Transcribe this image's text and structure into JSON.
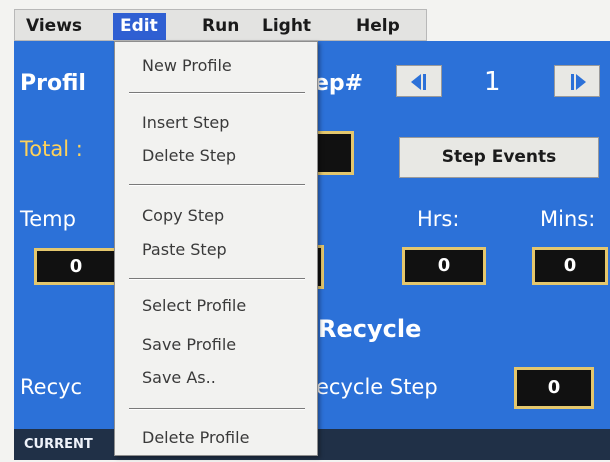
{
  "menubar": {
    "items": [
      "Views",
      "Edit",
      "Run",
      "Light",
      "Help"
    ],
    "active": "Edit"
  },
  "screen": {
    "profile_label": "Profil",
    "step_label": "ep#",
    "step_value": "1",
    "total_label": "Total :",
    "step_events_label": "Step Events",
    "temp_label": "Temp",
    "temp_value": "0",
    "hrs_label": "Hrs:",
    "hrs_value": "0",
    "mins_label": "Mins:",
    "mins_value": "0",
    "recycle_heading": "Recycle",
    "recycles_label": "Recyc",
    "recycle_step_label": "ecycle Step",
    "recycle_step_value": "0"
  },
  "status": {
    "text": "CURRENT"
  },
  "dropdown": {
    "items": [
      "New Profile",
      "Insert Step",
      "Delete Step",
      "Copy Step",
      "Paste Step",
      "Select Profile",
      "Save Profile",
      "Save As..",
      "Delete Profile"
    ]
  },
  "colors": {
    "screen_bg": "#2c71d8",
    "menu_highlight": "#2f5fd2",
    "field_border": "#e4c76d",
    "status_bg": "#203047",
    "total_label": "#ffd25a"
  }
}
